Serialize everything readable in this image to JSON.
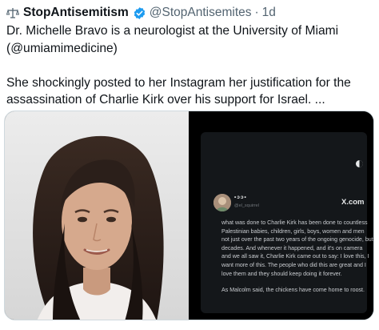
{
  "tweet": {
    "display_name": "StopAntisemitism",
    "username": "@StopAntisemites",
    "separator": "·",
    "time": "1d",
    "text_line1": "Dr. Michelle Bravo is a neurologist at the University of Miami (@umiamimedicine)",
    "text_line2": "She shockingly posted to her Instagram her justification for the assassination of Charlie Kirk over his support for Israel. ..."
  },
  "embedded_card": {
    "name": "•ɔɔ•",
    "handle": "@el_squirrel",
    "brand": "X.com",
    "paragraph1": "what was done to Charlie Kirk has been done to countless Palestinian babies, children, girls, boys, women and men not just over the past two years of the ongoing genocide, but decades. And whenever it happened, and it's on camera and we all saw it, Charlie Kirk came out to say: I love this, I want more of this. The people who did this are great and I love them and they should keep doing it forever.",
    "paragraph2": "As Malcolm said, the chickens have come home to roost."
  },
  "icons": {
    "handle_icon": "scale-icon",
    "verified": "verified-badge-icon",
    "toggle": "toggle-icon"
  },
  "colors": {
    "verified_blue": "#1d9bf0",
    "muted": "#536471",
    "card_bg": "#14171a"
  }
}
